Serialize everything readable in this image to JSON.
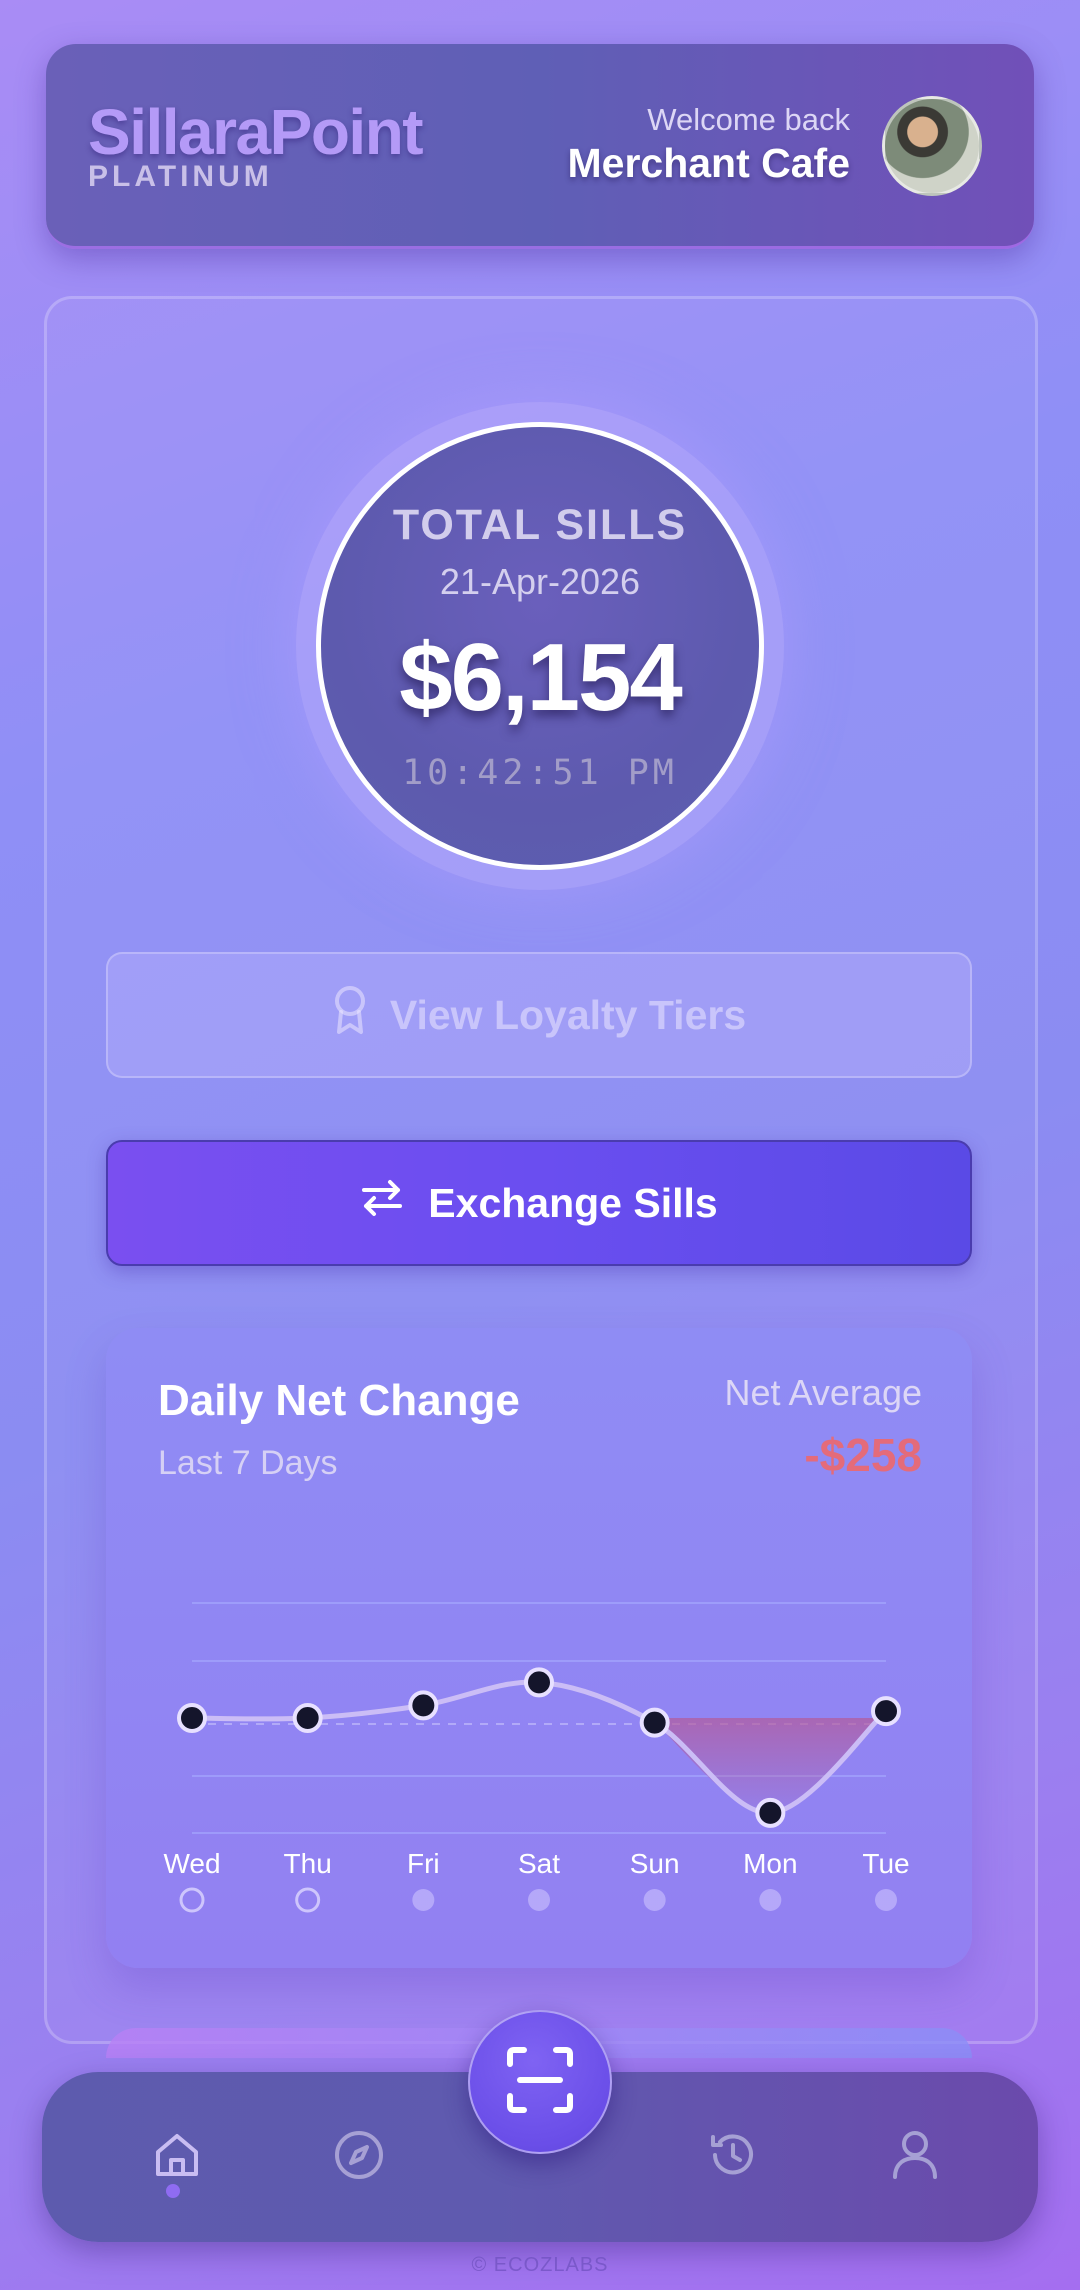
{
  "header": {
    "brand_name": "SillaraPoint",
    "brand_tier": "PLATINUM",
    "welcome_text": "Welcome back",
    "merchant_name": "Merchant Cafe"
  },
  "balance": {
    "label": "TOTAL SILLS",
    "date": "21-Apr-2026",
    "amount": "$6,154",
    "time": "10:42:51 PM"
  },
  "actions": {
    "loyalty_label": "View Loyalty Tiers",
    "exchange_label": "Exchange Sills"
  },
  "card": {
    "title": "Daily Net Change",
    "subtitle": "Last 7 Days",
    "avg_label": "Net Average",
    "avg_value": "-$258"
  },
  "chart_data": {
    "type": "line",
    "categories": [
      "Wed",
      "Thu",
      "Fri",
      "Sat",
      "Sun",
      "Mon",
      "Tue"
    ],
    "values": [
      0,
      0,
      220,
      620,
      -80,
      -1650,
      120
    ],
    "dot_states": [
      "hollow",
      "hollow",
      "filled",
      "filled",
      "filled",
      "filled",
      "filled"
    ],
    "ylim": [
      -2000,
      2000
    ],
    "grid": true,
    "colors": {
      "line": "#cbbdf6",
      "point": "#14152b",
      "negative_fill": "#b35a9a"
    }
  },
  "nav": {
    "items": [
      "home-icon",
      "compass-icon",
      "scan-icon",
      "history-icon",
      "user-icon"
    ],
    "active": "home-icon"
  },
  "footer": {
    "text": "ECOZLABS"
  }
}
